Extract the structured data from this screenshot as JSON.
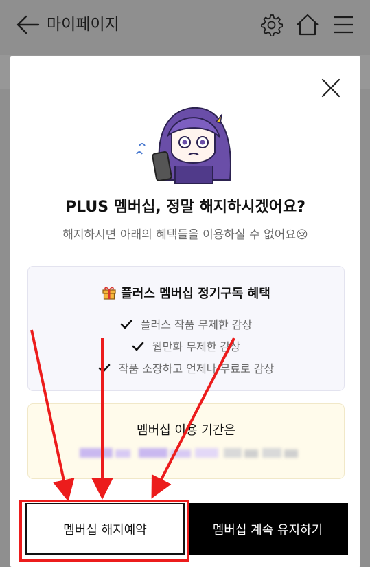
{
  "header": {
    "back_icon": "arrow-left-icon",
    "title": "마이페이지",
    "icons": [
      "gear-icon",
      "home-icon",
      "hamburger-menu-icon"
    ]
  },
  "modal": {
    "close_icon": "close-icon",
    "mascot": "mascot-illustration",
    "headline": "PLUS 멤버십, 정말 해지하시겠어요?",
    "subline": "해지하시면 아래의 혜택들을 이용하실 수 없어요😢",
    "benefits": {
      "title": "플러스 멤버십 정기구독 혜택",
      "title_icon": "gift-icon",
      "items": [
        "플러스 작품 무제한 감상",
        "웹만화 무제한 감상",
        "작품 소장하고 언제나 무료로 감상"
      ]
    },
    "period": {
      "title": "멤버십 이용 기간은"
    },
    "buttons": {
      "cancel": "멤버십 해지예약",
      "keep": "멤버십 계속 유지하기"
    }
  },
  "annotation": {
    "color": "#ec1c1c"
  },
  "colors": {
    "overlay": "#8f8f8f",
    "keep_button": "#000000",
    "benefit_box": "#f7f7fc",
    "period_box": "#fffbeb"
  }
}
